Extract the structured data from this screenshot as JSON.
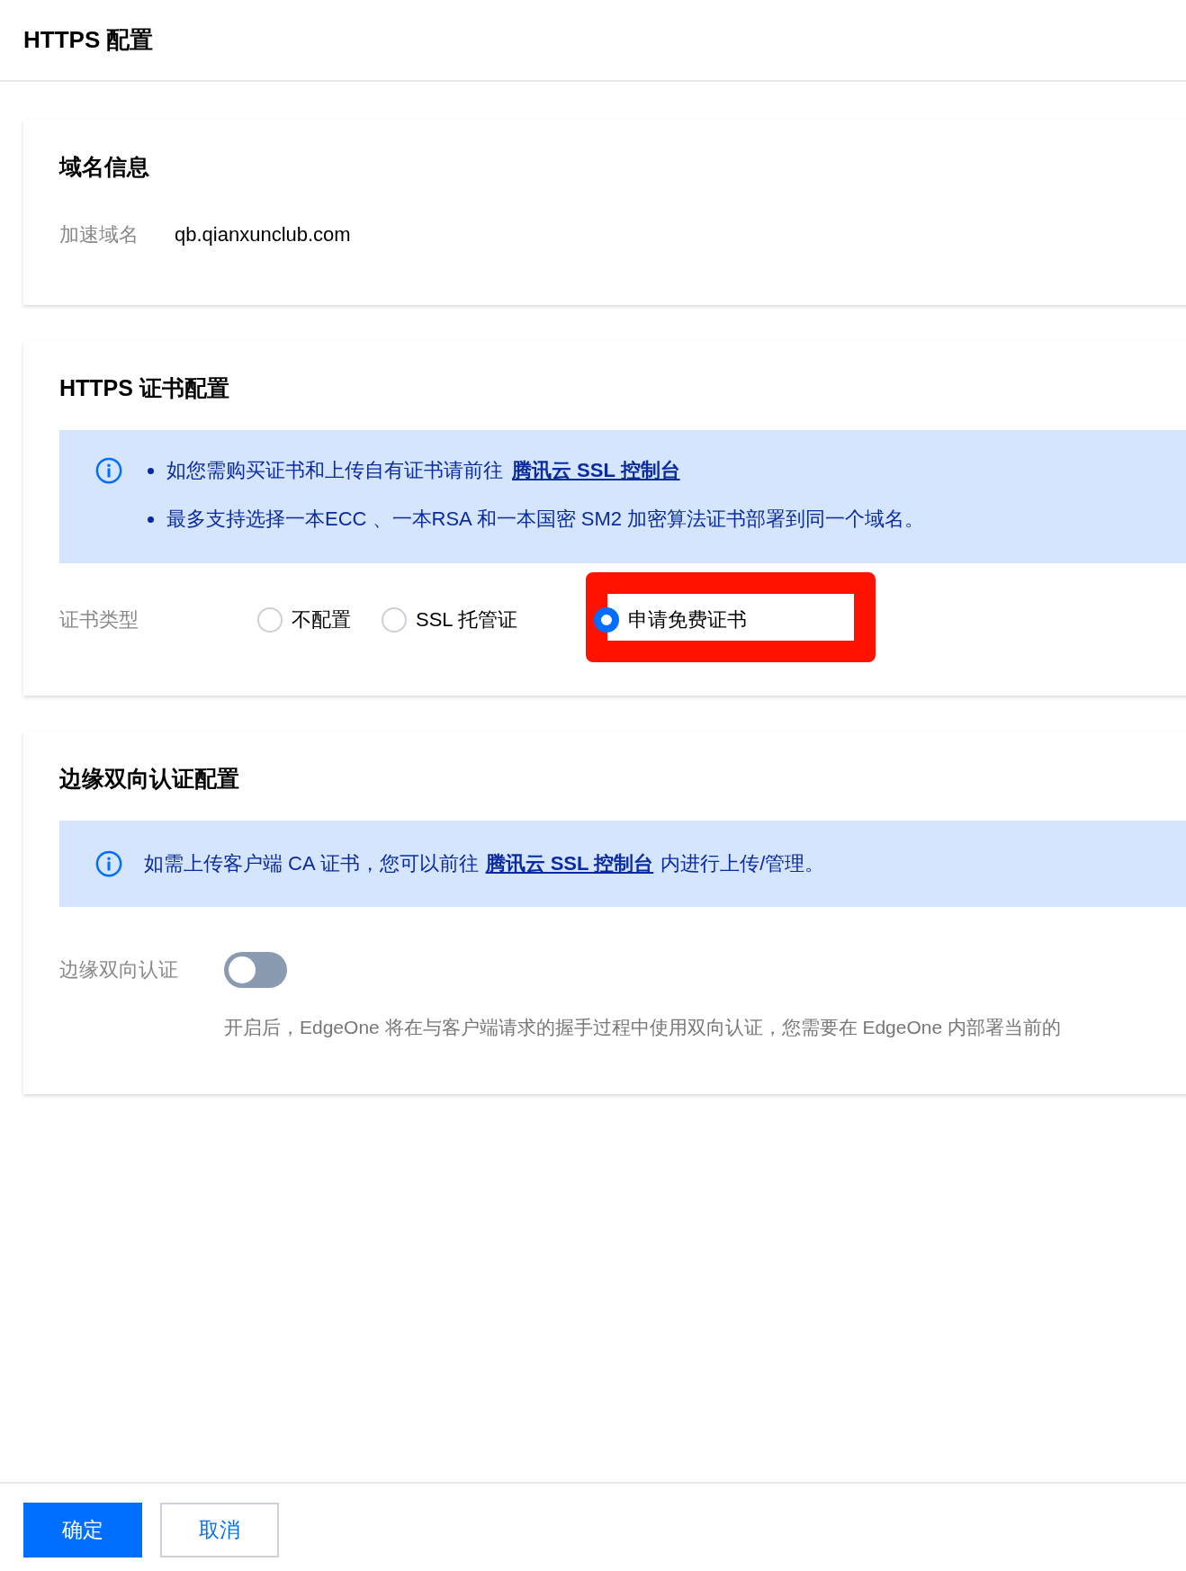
{
  "header": {
    "title": "HTTPS 配置"
  },
  "domain_card": {
    "title": "域名信息",
    "label": "加速域名",
    "value": "qb.qianxunclub.com"
  },
  "cert_card": {
    "title": "HTTPS 证书配置",
    "notice": {
      "items": [
        {
          "text": "如您需购买证书和上传自有证书请前往",
          "link": "腾讯云 SSL 控制台"
        },
        {
          "text": "最多支持选择一本ECC 、一本RSA 和一本国密 SM2 加密算法证书部署到同一个域名。"
        }
      ]
    },
    "label": "证书类型",
    "options": [
      {
        "label": "不配置",
        "selected": false
      },
      {
        "label": "SSL 托管证",
        "selected": false
      },
      {
        "label": "申请免费证书",
        "selected": true
      }
    ]
  },
  "mtls_card": {
    "title": "边缘双向认证配置",
    "notice": {
      "before": "如需上传客户端 CA 证书，您可以前往",
      "link": "腾讯云 SSL 控制台",
      "after": "内进行上传/管理。"
    },
    "label": "边缘双向认证",
    "on": false,
    "description": "开启后，EdgeOne 将在与客户端请求的握手过程中使用双向认证，您需要在 EdgeOne 内部署当前的"
  },
  "buttons": [
    {
      "label": "确定",
      "kind": "primary"
    },
    {
      "label": "取消",
      "kind": "secondary"
    }
  ]
}
